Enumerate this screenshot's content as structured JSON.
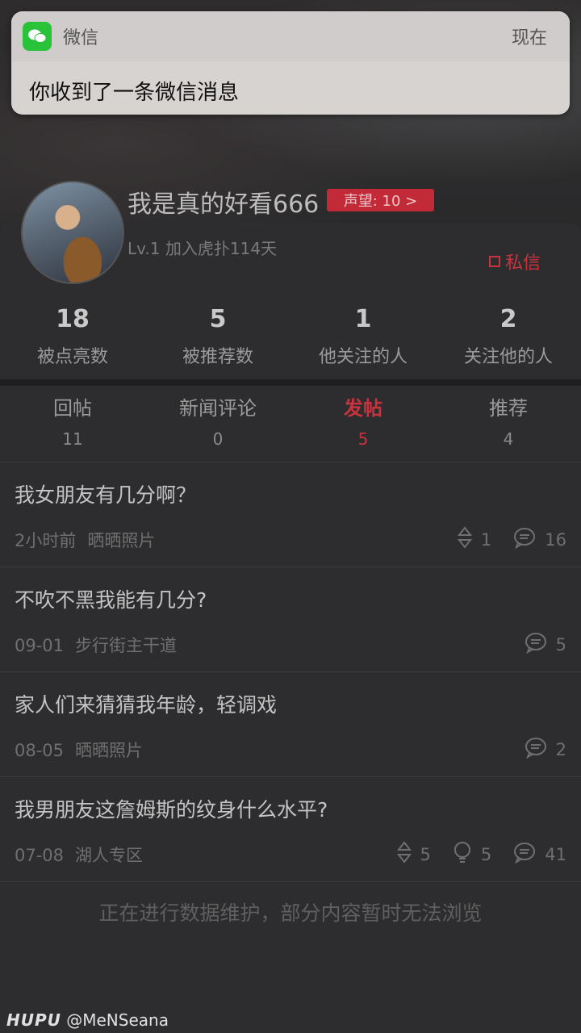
{
  "notification": {
    "app_name": "微信",
    "time": "现在",
    "message": "你收到了一条微信消息"
  },
  "profile": {
    "username": "我是真的好看666",
    "reputation_label": "声望: 10 >",
    "level": "Lv.1 加入虎扑114天",
    "dm_label": "私信"
  },
  "stats": [
    {
      "num": "18",
      "label": "被点亮数"
    },
    {
      "num": "5",
      "label": "被推荐数"
    },
    {
      "num": "1",
      "label": "他关注的人"
    },
    {
      "num": "2",
      "label": "关注他的人"
    }
  ],
  "tabs": [
    {
      "label": "回帖",
      "count": "11"
    },
    {
      "label": "新闻评论",
      "count": "0"
    },
    {
      "label": "发帖",
      "count": "5"
    },
    {
      "label": "推荐",
      "count": "4"
    }
  ],
  "posts": [
    {
      "title": "我女朋友有几分啊？",
      "date": "2小时前",
      "board": "晒晒照片",
      "likes": "1",
      "comments": "16"
    },
    {
      "title": "不吹不黑我能有几分?",
      "date": "09-01",
      "board": "步行街主干道",
      "comments": "5"
    },
    {
      "title": "家人们来猜猜我年龄，轻调戏",
      "date": "08-05",
      "board": "晒晒照片",
      "comments": "2"
    },
    {
      "title": "我男朋友这詹姆斯的纹身什么水平?",
      "date": "07-08",
      "board": "湖人专区",
      "likes": "5",
      "recommends": "5",
      "comments": "41"
    }
  ],
  "footer_note": "正在进行数据维护，部分内容暂时无法浏览",
  "watermark": {
    "brand": "HUPU",
    "handle": "@MeNSeana"
  },
  "colors": {
    "accent": "#c8333e",
    "wechat": "#29c33a"
  }
}
